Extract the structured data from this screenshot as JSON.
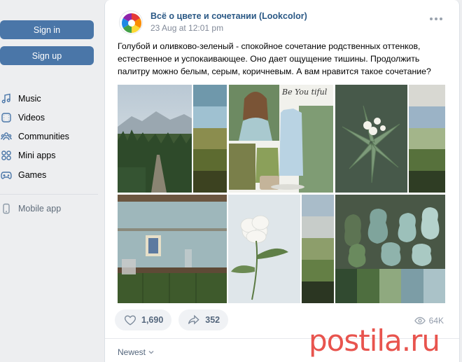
{
  "sidebar": {
    "sign_in": "Sign in",
    "sign_up": "Sign up",
    "items": [
      {
        "label": "Music",
        "icon": "music-icon"
      },
      {
        "label": "Videos",
        "icon": "video-icon"
      },
      {
        "label": "Communities",
        "icon": "communities-icon"
      },
      {
        "label": "Mini apps",
        "icon": "mini-apps-icon"
      },
      {
        "label": "Games",
        "icon": "gamepad-icon"
      }
    ],
    "mobile_app": {
      "label": "Mobile app",
      "icon": "phone-icon"
    }
  },
  "post": {
    "author": "Всё о цвете и сочетании (Lookcolor)",
    "date": "23 Aug at 12:01 pm",
    "text": "Голубой и оливково-зеленый - спокойное сочетание родственных оттенков, естественное и успокаивающее. Оно дает ощущение тишины. Продолжить палитру можно белым, серым, коричневым. А вам нравится такое сочетание?",
    "likes": "1,690",
    "shares": "352",
    "views": "64K",
    "sort_label": "Newest",
    "collage_text": "Be You tiful"
  },
  "palette": {
    "swatches_a": [
      "#6f98ab",
      "#9fc1d1",
      "#8b8d4e",
      "#5d6b30",
      "#3c4220"
    ],
    "swatches_b": [
      "#d8d8d2",
      "#9bb3c6",
      "#a3b58a",
      "#57713c",
      "#2f3d24"
    ],
    "swatches_c": [
      "#a9bcc9",
      "#c7ccc9",
      "#8d9e6b",
      "#647f45",
      "#2b3622"
    ],
    "swatches_d": [
      "#314a30",
      "#4e6e3f",
      "#8fa97f",
      "#7c9da6",
      "#aac2c8"
    ]
  },
  "watermark": "postila.ru",
  "colors": {
    "accent": "#4a76a8",
    "link": "#2a5885",
    "muted": "#828a99"
  }
}
